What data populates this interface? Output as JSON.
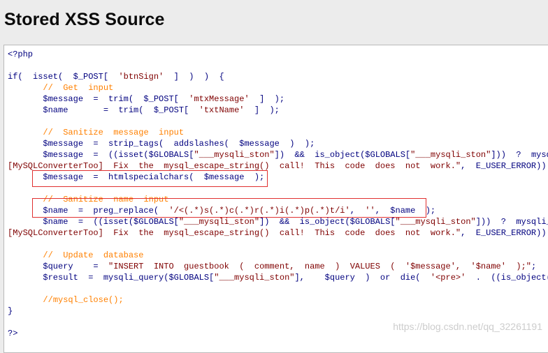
{
  "page": {
    "title": "Stored XSS Source"
  },
  "code": {
    "lines": [
      [
        {
          "t": "<?php",
          "c": "d"
        }
      ],
      [],
      [
        {
          "t": "if(  isset(  $_POST[  ",
          "c": "d"
        },
        {
          "t": "'btnSign'",
          "c": "s"
        },
        {
          "t": "  ]  )  )  {",
          "c": "d"
        }
      ],
      [
        {
          "t": "       ",
          "c": "d"
        },
        {
          "t": "//  Get  input",
          "c": "c"
        }
      ],
      [
        {
          "t": "       $message  =  trim(  $_POST[  ",
          "c": "d"
        },
        {
          "t": "'mtxMessage'",
          "c": "s"
        },
        {
          "t": "  ]  );",
          "c": "d"
        }
      ],
      [
        {
          "t": "       $name       =  trim(  $_POST[  ",
          "c": "d"
        },
        {
          "t": "'txtName'",
          "c": "s"
        },
        {
          "t": "  ]  );",
          "c": "d"
        }
      ],
      [],
      [
        {
          "t": "       ",
          "c": "d"
        },
        {
          "t": "//  Sanitize  message  input",
          "c": "c"
        }
      ],
      [
        {
          "t": "       $message  =  strip_tags(  addslashes(  $message  )  );",
          "c": "d"
        }
      ],
      [
        {
          "t": "       $message  =  ((isset($GLOBALS[",
          "c": "d"
        },
        {
          "t": "\"___mysqli_ston\"",
          "c": "s"
        },
        {
          "t": "])  &&  is_object($GLOBALS[",
          "c": "d"
        },
        {
          "t": "\"___mysqli_ston\"",
          "c": "s"
        },
        {
          "t": "]))  ?  mysqli_real_escape_string(",
          "c": "d"
        }
      ],
      [
        {
          "t": "[MySQLConverterToo]  Fix  the  mysql_escape_string()  call!  This  code  does  not  work.\"",
          "c": "s"
        },
        {
          "t": ",  E_USER_ERROR))  ?  \"\"  :  \"\"));",
          "c": "d"
        }
      ],
      [
        {
          "t": "       $message  =  htmlspecialchars(  $message  );",
          "c": "d"
        }
      ],
      [],
      [
        {
          "t": "       ",
          "c": "d"
        },
        {
          "t": "//  Sanitize  name  input",
          "c": "c"
        }
      ],
      [
        {
          "t": "       $name  =  preg_replace(  ",
          "c": "d"
        },
        {
          "t": "'/<(.*)s(.*)c(.*)r(.*)i(.*)p(.*)t/i'",
          "c": "s"
        },
        {
          "t": ",  ",
          "c": "d"
        },
        {
          "t": "''",
          "c": "s"
        },
        {
          "t": ",  $name  );",
          "c": "d"
        }
      ],
      [
        {
          "t": "       $name  =  ((isset($GLOBALS[",
          "c": "d"
        },
        {
          "t": "\"___mysqli_ston\"",
          "c": "s"
        },
        {
          "t": "])  &&  is_object($GLOBALS[",
          "c": "d"
        },
        {
          "t": "\"___mysqli_ston\"",
          "c": "s"
        },
        {
          "t": "]))  ?  mysqli_real_escape_string(",
          "c": "d"
        }
      ],
      [
        {
          "t": "[MySQLConverterToo]  Fix  the  mysql_escape_string()  call!  This  code  does  not  work.\"",
          "c": "s"
        },
        {
          "t": ",  E_USER_ERROR))  ?  \"\"  :  \"\"));",
          "c": "d"
        }
      ],
      [],
      [
        {
          "t": "       ",
          "c": "d"
        },
        {
          "t": "//  Update  database",
          "c": "c"
        }
      ],
      [
        {
          "t": "       $query    =  ",
          "c": "d"
        },
        {
          "t": "\"INSERT  INTO  guestbook  (  comment,  name  )  VALUES  (  '$message',  '$name'  );\"",
          "c": "s"
        },
        {
          "t": ";",
          "c": "d"
        }
      ],
      [
        {
          "t": "       $result  =  mysqli_query($GLOBALS[",
          "c": "d"
        },
        {
          "t": "\"___mysqli_ston\"",
          "c": "s"
        },
        {
          "t": "],    $query  )  or  die(  ",
          "c": "d"
        },
        {
          "t": "'<pre>'",
          "c": "s"
        },
        {
          "t": "  .  ((is_object($GLOBALS[",
          "c": "d"
        }
      ],
      [],
      [
        {
          "t": "       ",
          "c": "d"
        },
        {
          "t": "//mysql_close();",
          "c": "c"
        }
      ],
      [
        {
          "t": "}",
          "c": "d"
        }
      ],
      [],
      [
        {
          "t": "?>",
          "c": "d"
        }
      ]
    ]
  },
  "watermark": "https://blog.csdn.net/qq_32261191",
  "colors": {
    "default_code": "#00007f",
    "comment": "#ff8000",
    "string": "#7f0000",
    "highlight_border": "#e03030"
  }
}
